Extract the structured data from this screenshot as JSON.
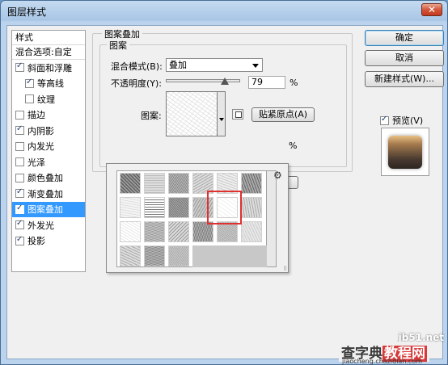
{
  "window": {
    "title": "图层样式",
    "close_glyph": "✕"
  },
  "style_list": {
    "header": "样式",
    "blend_default": "混合选项:自定",
    "items": [
      {
        "label": "斜面和浮雕",
        "checked": true,
        "sub": false,
        "selected": false
      },
      {
        "label": "等高线",
        "checked": true,
        "sub": true,
        "selected": false
      },
      {
        "label": "纹理",
        "checked": false,
        "sub": true,
        "selected": false
      },
      {
        "label": "描边",
        "checked": false,
        "sub": false,
        "selected": false
      },
      {
        "label": "内阴影",
        "checked": true,
        "sub": false,
        "selected": false
      },
      {
        "label": "内发光",
        "checked": false,
        "sub": false,
        "selected": false
      },
      {
        "label": "光泽",
        "checked": false,
        "sub": false,
        "selected": false
      },
      {
        "label": "颜色叠加",
        "checked": false,
        "sub": false,
        "selected": false
      },
      {
        "label": "渐变叠加",
        "checked": true,
        "sub": false,
        "selected": false
      },
      {
        "label": "图案叠加",
        "checked": true,
        "sub": false,
        "selected": true
      },
      {
        "label": "外发光",
        "checked": true,
        "sub": false,
        "selected": false
      },
      {
        "label": "投影",
        "checked": true,
        "sub": false,
        "selected": false
      }
    ]
  },
  "panel": {
    "outer_title": "图案叠加",
    "inner_title": "图案",
    "blend_mode_label": "混合模式(B):",
    "blend_mode_value": "叠加",
    "opacity_label": "不透明度(Y):",
    "opacity_value": "79",
    "opacity_unit": "%",
    "opacity_fraction": 0.79,
    "pattern_label": "图案:",
    "snap_button": "贴紧原点(A)",
    "hidden_pct": "%"
  },
  "picker": {
    "gear_icon": "⚙",
    "grip": "⠿",
    "selected_index": 10
  },
  "buttons": {
    "ok": "确定",
    "cancel": "取消",
    "new_style": "新建样式(W)...",
    "preview_label": "预览(V)",
    "preview_checked": true
  },
  "watermark": {
    "top": "jb51.net",
    "main_left": "查字典",
    "main_mid": "教程网",
    "sub": "jiaocheng.chazidian.com"
  }
}
